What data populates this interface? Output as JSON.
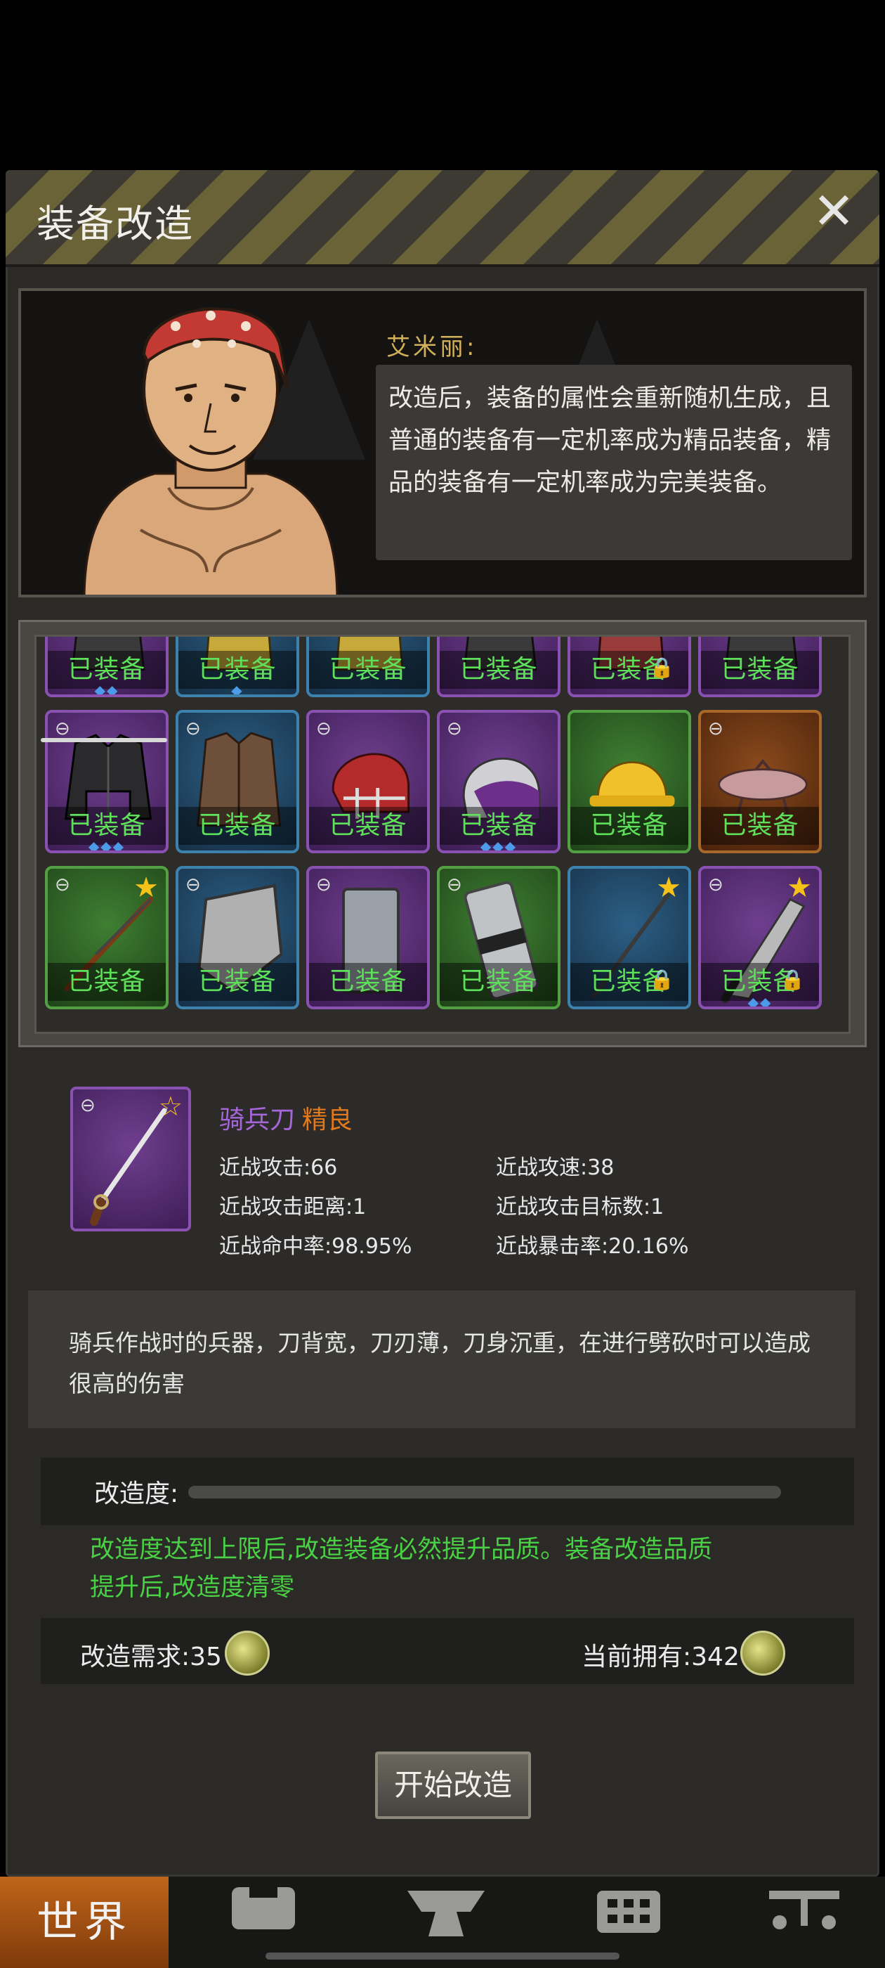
{
  "header": {
    "title": "装备改造",
    "close_icon": "close-icon"
  },
  "npc": {
    "name": "艾米丽:",
    "dialog": "改造后，装备的属性会重新随机生成，且普通的装备有一定机率成为精品装备，精品的装备有一定机率成为完美装备。"
  },
  "inventory": {
    "equipped_label": "已装备",
    "rows": [
      [
        {
          "color": "purple",
          "icon": "armor-icon",
          "link": false,
          "star": false,
          "lock": false,
          "gems": 2
        },
        {
          "color": "blue",
          "icon": "gold-armor-icon",
          "link": false,
          "star": false,
          "lock": false,
          "gems": 1
        },
        {
          "color": "blue",
          "icon": "gold-armor-icon",
          "link": false,
          "star": false,
          "lock": false,
          "gems": 0
        },
        {
          "color": "purple",
          "icon": "armor-icon",
          "link": false,
          "star": false,
          "lock": false,
          "gems": 0
        },
        {
          "color": "purple",
          "icon": "red-armor-icon",
          "link": false,
          "star": false,
          "lock": true,
          "gems": 0
        },
        {
          "color": "purple",
          "icon": "armor-icon",
          "link": false,
          "star": false,
          "lock": false,
          "gems": 0
        }
      ],
      [
        {
          "color": "purple",
          "icon": "black-jacket-icon",
          "link": true,
          "star": false,
          "lock": false,
          "gems": 3
        },
        {
          "color": "blue",
          "icon": "leather-coat-icon",
          "link": true,
          "star": false,
          "lock": false,
          "gems": 0
        },
        {
          "color": "purple",
          "icon": "football-helmet-icon",
          "link": true,
          "star": false,
          "lock": false,
          "gems": 0
        },
        {
          "color": "purple",
          "icon": "police-helmet-icon",
          "link": true,
          "star": false,
          "lock": false,
          "gems": 3
        },
        {
          "color": "green",
          "icon": "hard-hat-icon",
          "link": false,
          "star": false,
          "lock": false,
          "gems": 0
        },
        {
          "color": "orange",
          "icon": "pot-lid-icon",
          "link": true,
          "star": false,
          "lock": false,
          "gems": 0
        }
      ],
      [
        {
          "color": "green",
          "icon": "rifle-icon",
          "link": true,
          "star": true,
          "lock": false,
          "gems": 0
        },
        {
          "color": "blue",
          "icon": "shield-icon",
          "link": true,
          "star": false,
          "lock": false,
          "gems": 0
        },
        {
          "color": "purple",
          "icon": "riot-shield-icon",
          "link": true,
          "star": false,
          "lock": false,
          "gems": 0
        },
        {
          "color": "green",
          "icon": "steel-pipe-shield-icon",
          "link": true,
          "star": false,
          "lock": false,
          "gems": 0
        },
        {
          "color": "blue",
          "icon": "spear-icon",
          "link": false,
          "star": true,
          "lock": true,
          "gems": 0
        },
        {
          "color": "purple",
          "icon": "machete-icon",
          "link": true,
          "star": true,
          "lock": true,
          "gems": 2
        }
      ]
    ]
  },
  "detail": {
    "name": "骑兵刀",
    "quality": "精良",
    "icon": "saber-icon",
    "stats": [
      {
        "label": "近战攻击:66"
      },
      {
        "label": "近战攻速:38"
      },
      {
        "label": "近战攻击距离:1"
      },
      {
        "label": "近战攻击目标数:1"
      },
      {
        "label": "近战命中率:98.95%"
      },
      {
        "label": "近战暴击率:20.16%"
      }
    ],
    "description": "骑兵作战时的兵器，刀背宽，刀刃薄，刀身沉重，在进行劈砍时可以造成很高的伤害"
  },
  "progress": {
    "label": "改造度:",
    "value": 0,
    "hint": "改造度达到上限后,改造装备必然提升品质。装备改造品质提升后,改造度清零"
  },
  "cost": {
    "required": "改造需求:35",
    "owned": "当前拥有:342",
    "coin_icon": "bottle-cap-coin-icon"
  },
  "start_button": "开始改造",
  "bottom_nav": {
    "world": "世界",
    "icons": [
      "backpack-icon",
      "anvil-icon",
      "building-icon",
      "cart-icon"
    ]
  },
  "colors": {
    "equipped_text": "#5ee05a",
    "quality_orange": "#e07a1c",
    "name_purple": "#a567d8",
    "hint_green": "#49d044",
    "npc_name": "#d3b15a"
  }
}
